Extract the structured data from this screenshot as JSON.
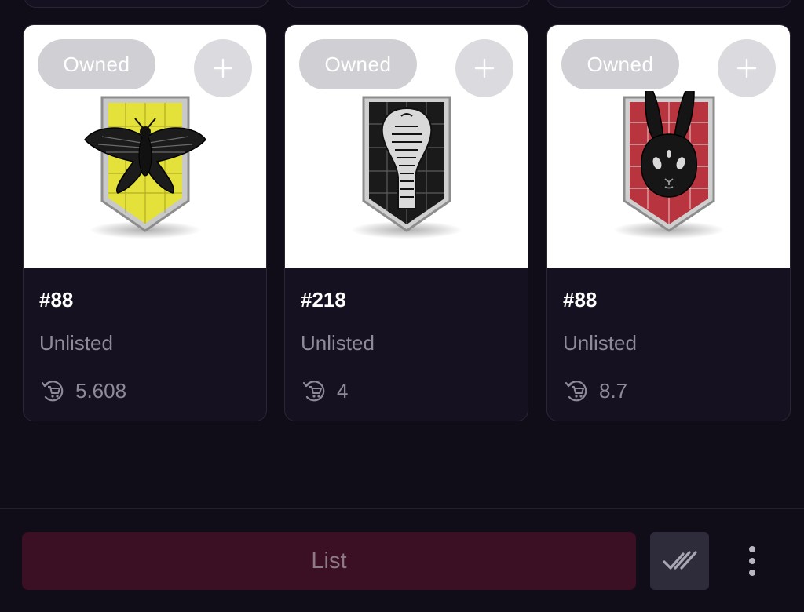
{
  "cards": [
    {
      "badge": "Owned",
      "token_id": "#88",
      "status": "Unlisted",
      "price": "5.608",
      "pin": "moth-pin",
      "pin_color": "#e4e23a"
    },
    {
      "badge": "Owned",
      "token_id": "#218",
      "status": "Unlisted",
      "price": "4",
      "pin": "cobra-pin",
      "pin_color": "#1a1a1a"
    },
    {
      "badge": "Owned",
      "token_id": "#88",
      "status": "Unlisted",
      "price": "8.7",
      "pin": "rabbit-pin",
      "pin_color": "#b8353f"
    }
  ],
  "footer": {
    "list_label": "List",
    "select_all_icon": "double-check-icon",
    "more_icon": "more-vertical-icon"
  },
  "colors": {
    "background": "#110d18",
    "card": "#151120",
    "list_button": "#3b0f24"
  }
}
